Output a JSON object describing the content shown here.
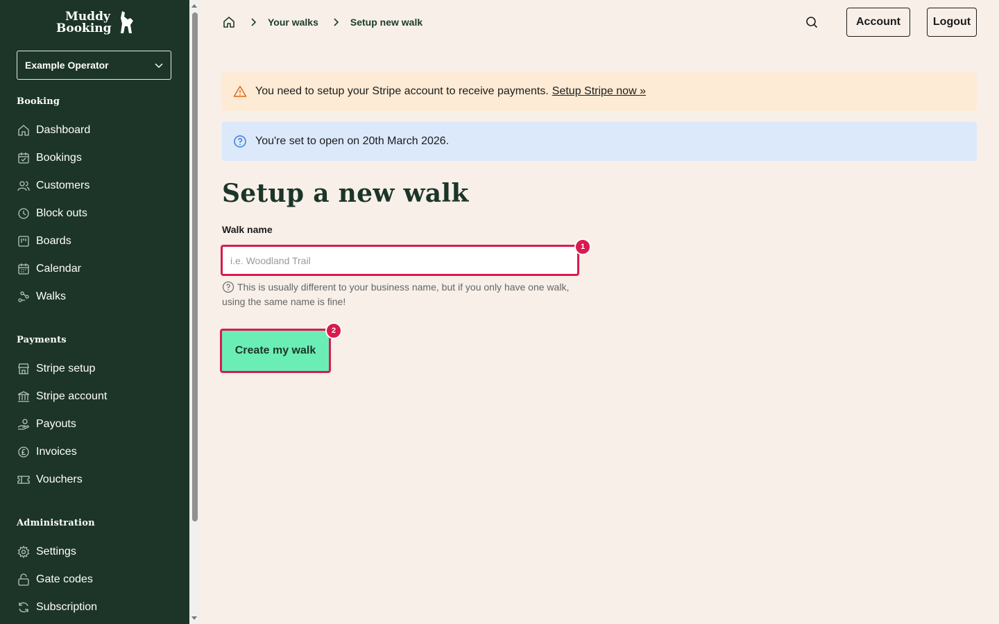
{
  "brand": {
    "line1": "Muddy",
    "line2": "Booking"
  },
  "operator": {
    "selected": "Example Operator"
  },
  "sidebar": {
    "sections": [
      {
        "title": "Booking",
        "items": [
          {
            "label": "Dashboard",
            "icon": "home-icon"
          },
          {
            "label": "Bookings",
            "icon": "calendar-check-icon"
          },
          {
            "label": "Customers",
            "icon": "users-icon"
          },
          {
            "label": "Block outs",
            "icon": "clock-icon"
          },
          {
            "label": "Boards",
            "icon": "board-icon"
          },
          {
            "label": "Calendar",
            "icon": "calendar-icon"
          },
          {
            "label": "Walks",
            "icon": "route-icon"
          }
        ]
      },
      {
        "title": "Payments",
        "items": [
          {
            "label": "Stripe setup",
            "icon": "store-icon"
          },
          {
            "label": "Stripe account",
            "icon": "bank-icon"
          },
          {
            "label": "Payouts",
            "icon": "payout-icon"
          },
          {
            "label": "Invoices",
            "icon": "pound-icon"
          },
          {
            "label": "Vouchers",
            "icon": "ticket-icon"
          }
        ]
      },
      {
        "title": "Administration",
        "items": [
          {
            "label": "Settings",
            "icon": "gear-icon"
          },
          {
            "label": "Gate codes",
            "icon": "lock-icon"
          },
          {
            "label": "Subscription",
            "icon": "refresh-icon"
          }
        ]
      }
    ]
  },
  "breadcrumb": {
    "items": [
      "Your walks",
      "Setup new walk"
    ]
  },
  "header": {
    "account_label": "Account",
    "logout_label": "Logout"
  },
  "alerts": {
    "warning": {
      "text": "You need to setup your Stripe account to receive payments.",
      "link": "Setup Stripe now »"
    },
    "info": {
      "text": "You're set to open on 20th March 2026."
    }
  },
  "form": {
    "title": "Setup a new walk",
    "walk_name_label": "Walk name",
    "walk_name_placeholder": "i.e. Woodland Trail",
    "walk_name_value": "",
    "hint": "This is usually different to your business name, but if you only have one walk, using the same name is fine!",
    "submit_label": "Create my walk"
  },
  "badges": [
    "1",
    "2"
  ],
  "colors": {
    "sidebar": "#1d3528",
    "accent": "#6aeeb6",
    "highlight": "#d91a4f",
    "warning_bg": "#fdebd5",
    "info_bg": "#dbe9fb"
  }
}
